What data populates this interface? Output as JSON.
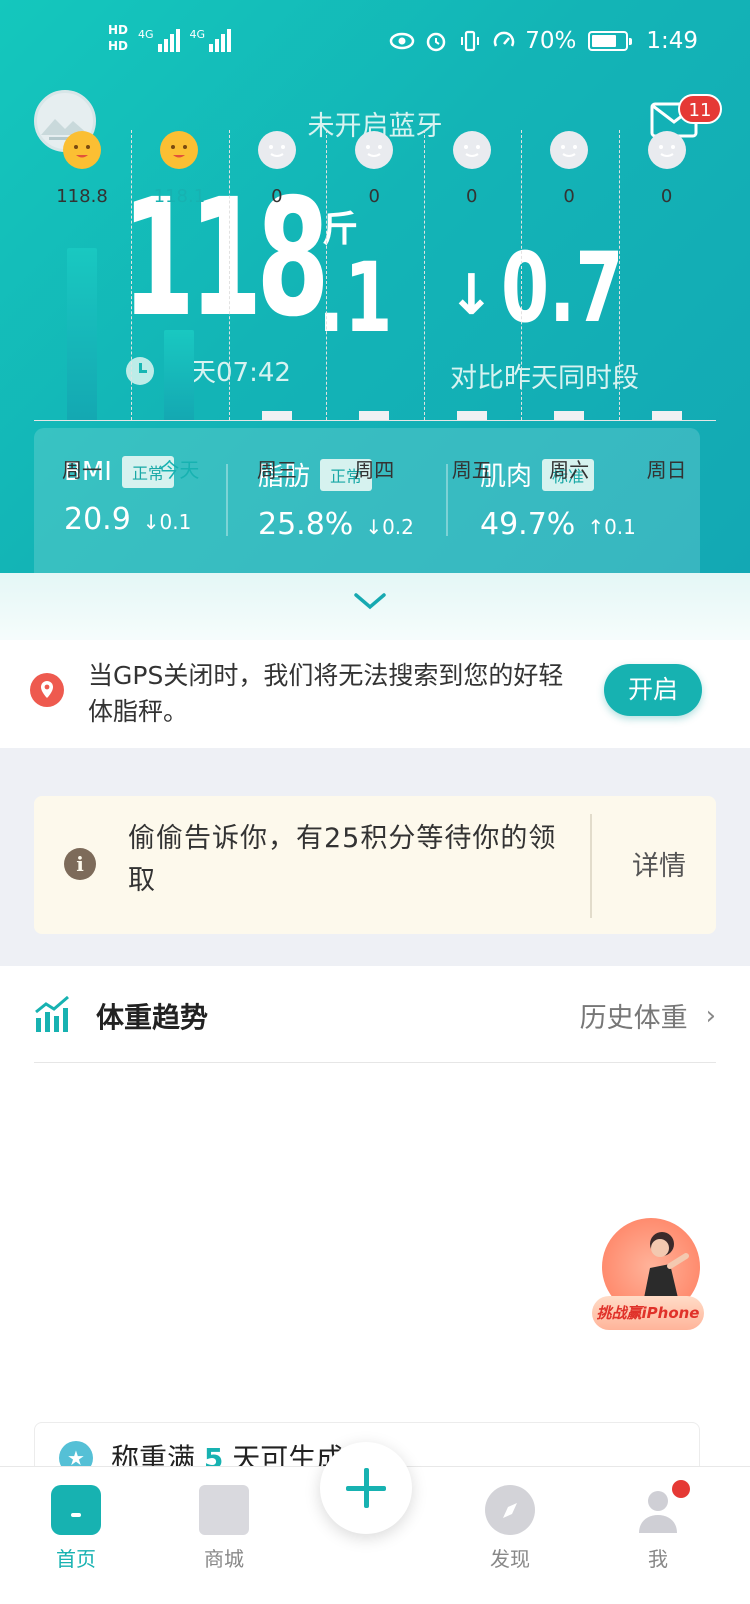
{
  "status": {
    "battery": "70%",
    "time": "1:49",
    "hd1": "HD",
    "hd2": "HD",
    "net1": "4G",
    "net2": "4G"
  },
  "header": {
    "bluetooth_status": "未开启蓝牙",
    "mail_badge": "11"
  },
  "weight": {
    "integer": "118",
    "decimal": ".1",
    "unit": "斤",
    "time": "今天07:42",
    "delta": "0.7",
    "delta_arrow": "↓",
    "compare_label": "对比昨天同时段"
  },
  "metrics": [
    {
      "name": "BMI",
      "tag": "正常",
      "value": "20.9",
      "delta": "↓0.1"
    },
    {
      "name": "脂肪",
      "tag": "正常",
      "value": "25.8%",
      "delta": "↓0.2"
    },
    {
      "name": "肌肉",
      "tag": "标准",
      "value": "49.7%",
      "delta": "↑0.1"
    }
  ],
  "gps": {
    "text": "当GPS关闭时，我们将无法搜索到您的好轻体脂秤。",
    "button": "开启"
  },
  "notice": {
    "text": "偷偷告诉你，有25积分等待你的领取",
    "button": "详情"
  },
  "trend": {
    "title": "体重趋势",
    "link": "历史体重",
    "link_arrow": "›"
  },
  "chart_data": {
    "type": "bar",
    "categories": [
      "周一",
      "今天",
      "周三",
      "周四",
      "周五",
      "周六",
      "周日"
    ],
    "values": [
      118.8,
      118.1,
      0,
      0,
      0,
      0,
      0
    ],
    "value_labels": [
      "118.8",
      "118.1",
      "0",
      "0",
      "0",
      "0",
      "0"
    ],
    "highlight_index": 1,
    "colors": {
      "bar": "#17b9b6",
      "highlight_text": "#17b2b1"
    }
  },
  "promo": {
    "label": "挑战赢iPhone"
  },
  "streak": {
    "prefix": "称重满 ",
    "number": "5",
    "suffix": " 天可生成..."
  },
  "tabbar": {
    "items": [
      {
        "label": "首页"
      },
      {
        "label": "商城"
      },
      {
        "label": "发现"
      },
      {
        "label": "我"
      }
    ]
  },
  "colors": {
    "accent": "#17b2b1",
    "badge": "#e53935"
  }
}
